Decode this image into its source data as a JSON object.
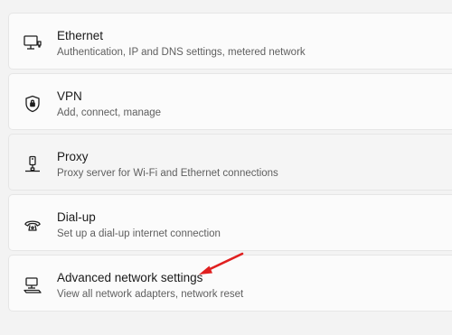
{
  "settings": {
    "items": [
      {
        "title": "Ethernet",
        "subtitle": "Authentication, IP and DNS settings, metered network",
        "icon": "ethernet-icon"
      },
      {
        "title": "VPN",
        "subtitle": "Add, connect, manage",
        "icon": "vpn-shield-icon"
      },
      {
        "title": "Proxy",
        "subtitle": "Proxy server for Wi-Fi and Ethernet connections",
        "icon": "proxy-icon"
      },
      {
        "title": "Dial-up",
        "subtitle": "Set up a dial-up internet connection",
        "icon": "dial-up-icon"
      },
      {
        "title": "Advanced network settings",
        "subtitle": "View all network adapters, network reset",
        "icon": "advanced-network-icon"
      }
    ]
  },
  "annotation": {
    "arrow_color": "#e02020",
    "icon": "red-arrow-icon"
  }
}
